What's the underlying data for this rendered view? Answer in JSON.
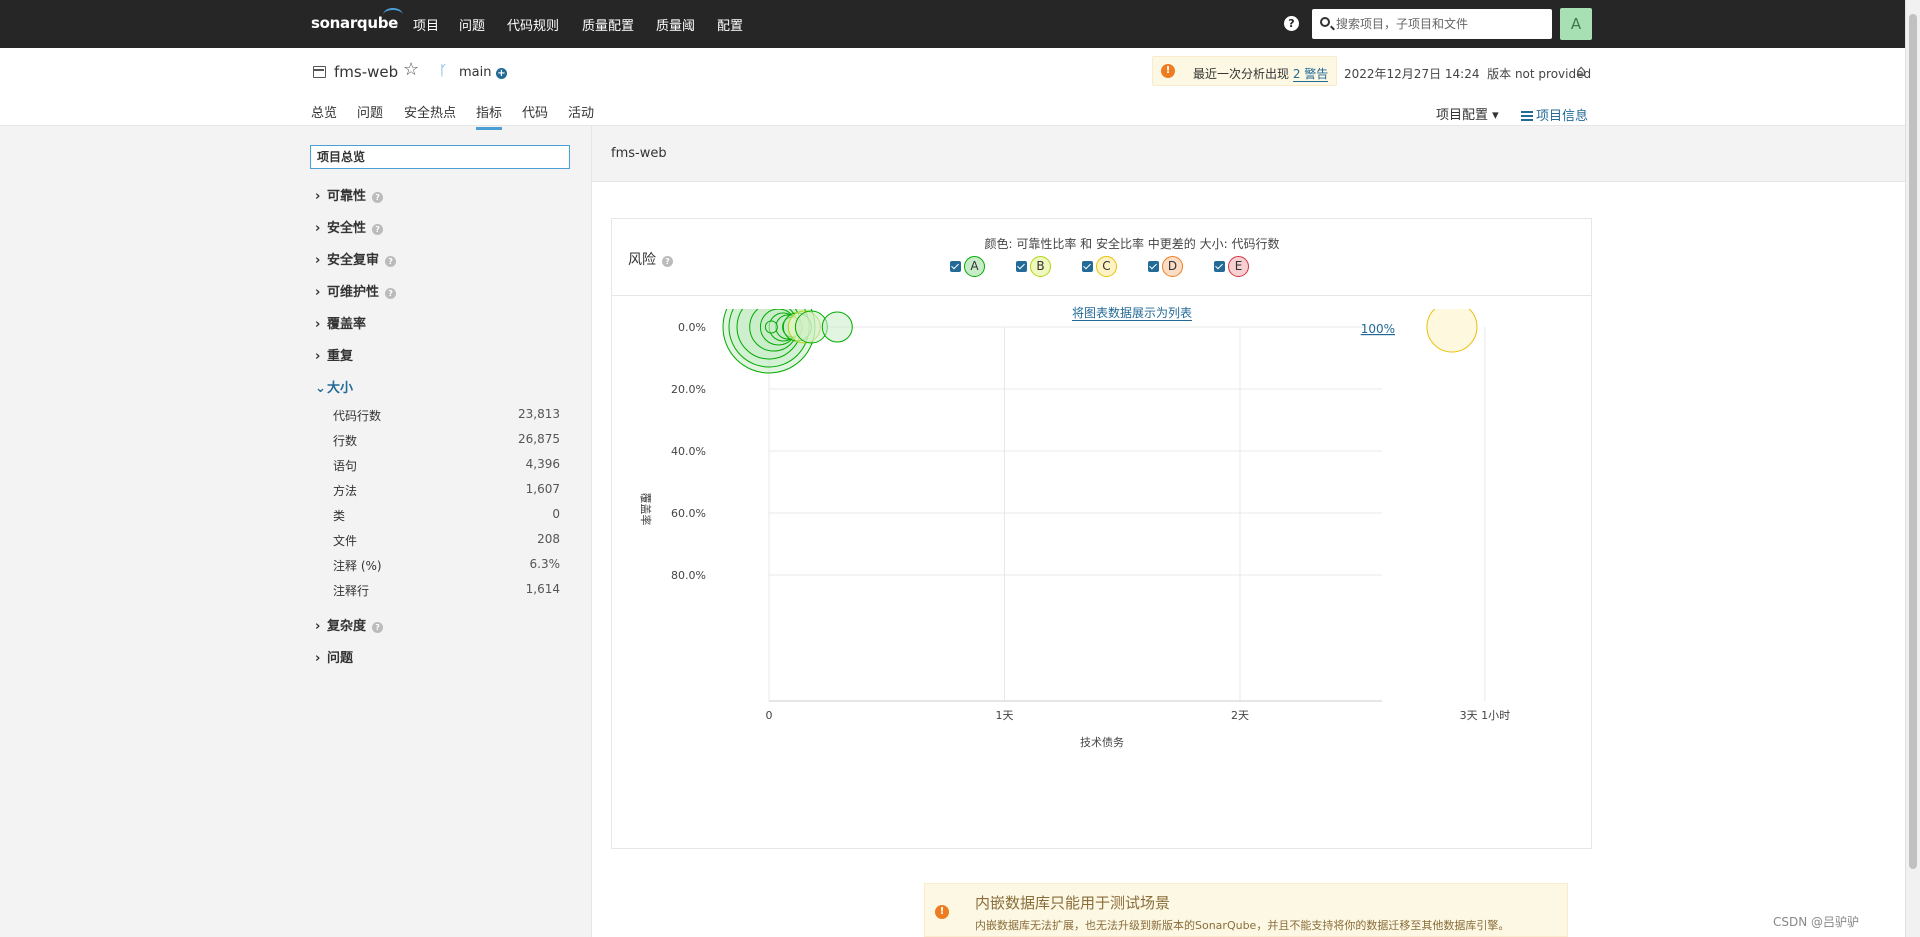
{
  "topnav": {
    "logo": "sonarqube",
    "items": [
      "项目",
      "问题",
      "代码规则",
      "质量配置",
      "质量阈",
      "配置"
    ],
    "search_placeholder": "搜索项目，子项目和文件",
    "avatar": "A"
  },
  "project": {
    "name": "fms-web",
    "branch": "main",
    "warning_text": "最近一次分析出现",
    "warning_link": "2 警告",
    "analysis_date": "2022年12月27日 14:24",
    "version": "版本 not provided",
    "tabs": [
      "总览",
      "问题",
      "安全热点",
      "指标",
      "代码",
      "活动"
    ],
    "active_tab": "指标",
    "config_label": "项目配置",
    "info_label": "项目信息"
  },
  "sidebar": {
    "search_value": "项目总览",
    "categories_top": [
      "可靠性",
      "安全性",
      "安全复审",
      "可维护性",
      "覆盖率",
      "重复"
    ],
    "open_category": "大小",
    "metrics": [
      {
        "label": "代码行数",
        "value": "23,813"
      },
      {
        "label": "行数",
        "value": "26,875"
      },
      {
        "label": "语句",
        "value": "4,396"
      },
      {
        "label": "方法",
        "value": "1,607"
      },
      {
        "label": "类",
        "value": "0"
      },
      {
        "label": "文件",
        "value": "208"
      },
      {
        "label": "注释 (%)",
        "value": "6.3%"
      },
      {
        "label": "注释行",
        "value": "1,614"
      }
    ],
    "categories_bottom": [
      "复杂度",
      "问题"
    ]
  },
  "main": {
    "breadcrumb": "fms-web",
    "risk_title": "风险",
    "legend_text": "颜色: 可靠性比率 和 安全比率 中更差的  大小: 代码行数",
    "legend": [
      {
        "label": "A",
        "color": "#00aa00",
        "bg": "#c8ecc8"
      },
      {
        "label": "B",
        "color": "#b0d513",
        "bg": "#f0f8c0"
      },
      {
        "label": "C",
        "color": "#eabe06",
        "bg": "#fdf3c2"
      },
      {
        "label": "D",
        "color": "#ed7d20",
        "bg": "#fbdcc4"
      },
      {
        "label": "E",
        "color": "#d4333f",
        "bg": "#f7d0d3"
      }
    ],
    "as_list": "将图表数据展示为列表",
    "zoom": "100%",
    "y_axis_label": "覆盖率",
    "x_axis_label": "技术债务"
  },
  "chart_data": {
    "type": "scatter",
    "title": "风险",
    "xlabel": "技术债务",
    "ylabel": "覆盖率",
    "x_ticks": [
      "0",
      "1天",
      "2天",
      "3天 1小时"
    ],
    "y_ticks": [
      "0.0%",
      "20.0%",
      "40.0%",
      "60.0%",
      "80.0%"
    ],
    "x_unit_note": "days",
    "xlim": [
      0,
      3.2
    ],
    "ylim": [
      0,
      100
    ],
    "points": [
      {
        "x": 0.0,
        "y": 0,
        "r": 46,
        "rating": "A"
      },
      {
        "x": 0.0,
        "y": 0,
        "r": 40,
        "rating": "A"
      },
      {
        "x": 0.0,
        "y": 0,
        "r": 32,
        "rating": "A"
      },
      {
        "x": 0.02,
        "y": 0,
        "r": 24,
        "rating": "A"
      },
      {
        "x": 0.04,
        "y": 0,
        "r": 18,
        "rating": "A"
      },
      {
        "x": 0.06,
        "y": 0,
        "r": 14,
        "rating": "A"
      },
      {
        "x": 0.08,
        "y": 0,
        "r": 12,
        "rating": "A"
      },
      {
        "x": 0.1,
        "y": 0,
        "r": 10,
        "rating": "A"
      },
      {
        "x": 0.12,
        "y": 0,
        "r": 14,
        "rating": "A"
      },
      {
        "x": 0.15,
        "y": 0,
        "r": 16,
        "rating": "B"
      },
      {
        "x": 0.18,
        "y": 0,
        "r": 16,
        "rating": "A"
      },
      {
        "x": 0.29,
        "y": 0,
        "r": 15,
        "rating": "A"
      },
      {
        "x": 0.01,
        "y": 0,
        "r": 6,
        "rating": "A"
      },
      {
        "x": 2.9,
        "y": 0,
        "r": 25,
        "rating": "C"
      }
    ]
  },
  "db_warning": {
    "title": "内嵌数据库只能用于测试场景",
    "desc": "内嵌数据库无法扩展，也无法升级到新版本的SonarQube，并且不能支持将你的数据迁移至其他数据库引擎。"
  },
  "watermark": "CSDN @吕驴驴"
}
